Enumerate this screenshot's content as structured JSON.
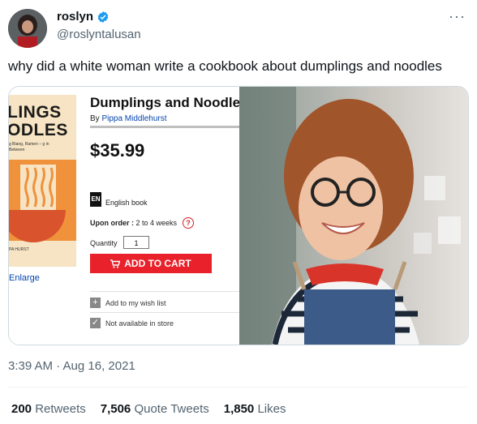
{
  "author": {
    "name": "roslyn",
    "handle": "@roslyntalusan"
  },
  "tweet_text": "why did a white woman write a cookbook about dumplings and noodles",
  "product": {
    "cover_title_1": "LINGS",
    "cover_title_2": "ODLES",
    "cover_sub": "g Biang, Ramen – g in Between",
    "cover_author": "PA HURST",
    "enlarge": "Enlarge",
    "title": "Dumplings and Noodles",
    "by_prefix": "By",
    "author": "Pippa Middlehurst",
    "price": "$35.99",
    "lang_icon": "EN",
    "lang": "English book",
    "upon_label": "Upon order :",
    "upon_value": "2 to 4 weeks",
    "help": "?",
    "qty_label": "Quantity",
    "qty_value": "1",
    "cart": "ADD TO CART",
    "wishlist": "Add to my wish list",
    "store": "Not available in store"
  },
  "timestamp": "3:39 AM · Aug 16, 2021",
  "stats": {
    "retweets_count": "200",
    "retweets_label": "Retweets",
    "quotes_count": "7,506",
    "quotes_label": "Quote Tweets",
    "likes_count": "1,850",
    "likes_label": "Likes"
  },
  "colors": {
    "verified": "#1d9bf0",
    "cart": "#e8212a",
    "link": "#0645ad"
  }
}
